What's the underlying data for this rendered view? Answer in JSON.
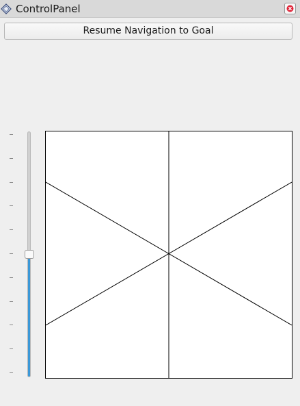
{
  "window": {
    "title": "ControlPanel",
    "icon": "diamond-icon",
    "close_icon": "close-icon"
  },
  "controls": {
    "resume_label": "Resume Navigation to Goal"
  },
  "slider": {
    "orientation": "vertical",
    "value_fraction": 0.5,
    "tick_count": 11,
    "fill_color": "#3c98d7"
  },
  "drive_pad": {
    "background": "#ffffff",
    "line_color": "#000000"
  }
}
